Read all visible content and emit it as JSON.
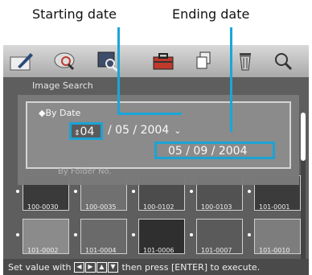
{
  "callouts": {
    "starting_date": "Starting date",
    "ending_date": "Ending date"
  },
  "toolbar": {
    "icons": [
      "pen-icon",
      "magnifier-search-icon",
      "image-search-icon",
      "toolbox-icon",
      "copy-icon",
      "trash-icon",
      "zoom-icon"
    ]
  },
  "menu": {
    "bg_title": "Image Search",
    "bg_item": "By Folder No."
  },
  "dialog": {
    "heading": "◆By Date",
    "start_day": "04",
    "start_rest": "/ 05 / 2004",
    "end_date": "05 / 09 / 2004"
  },
  "thumbnails": [
    {
      "label": "100-0030"
    },
    {
      "label": "100-0035"
    },
    {
      "label": "100-0102"
    },
    {
      "label": "100-0103"
    },
    {
      "label": "101-0001"
    },
    {
      "label": "101-0002"
    },
    {
      "label": "101-0004"
    },
    {
      "label": "101-0006"
    },
    {
      "label": "101-0007"
    },
    {
      "label": "101-0010"
    }
  ],
  "status": {
    "prefix": "Set value with",
    "keys": [
      "◀",
      "▶",
      "▲",
      "▼"
    ],
    "middle": "then press",
    "enter_key": "[ENTER]",
    "suffix": "to execute."
  },
  "colors": {
    "callout_accent": "#1aa6d8"
  }
}
